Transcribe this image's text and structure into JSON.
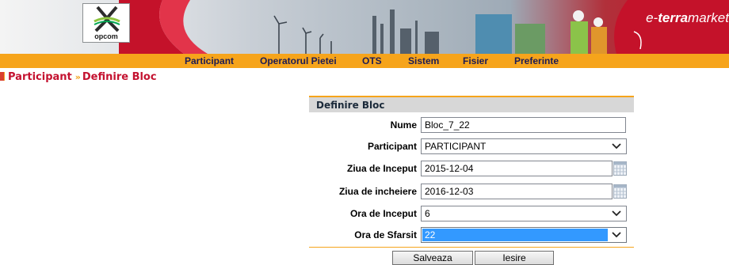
{
  "header": {
    "logo_text": "opcom",
    "brand_prefix": "e-",
    "brand_bold": "terra",
    "brand_suffix": "market"
  },
  "nav": {
    "items": [
      {
        "label": "Participant"
      },
      {
        "label": "Operatorul Pietei"
      },
      {
        "label": "OTS"
      },
      {
        "label": "Sistem"
      },
      {
        "label": "Fisier"
      },
      {
        "label": "Preferinte"
      }
    ]
  },
  "breadcrumb": {
    "parent": "Participant",
    "separator": "»",
    "current": "Definire Bloc"
  },
  "form": {
    "title": "Definire Bloc",
    "nume": {
      "label": "Nume",
      "value": "Bloc_7_22"
    },
    "participant": {
      "label": "Participant",
      "value": "PARTICIPANT"
    },
    "ziua_inceput": {
      "label": "Ziua de Inceput",
      "value": "2015-12-04"
    },
    "ziua_incheiere": {
      "label": "Ziua de incheiere",
      "value": "2016-12-03"
    },
    "ora_inceput": {
      "label": "Ora de Inceput",
      "value": "6"
    },
    "ora_sfarsit": {
      "label": "Ora de Sfarsit",
      "value": "22"
    }
  },
  "buttons": {
    "save": "Salveaza",
    "exit": "Iesire"
  },
  "colors": {
    "nav_bar": "#f6a41b",
    "brand_red": "#c4122a",
    "breadcrumb": "#c41230",
    "selected_field": "#3399ff"
  }
}
